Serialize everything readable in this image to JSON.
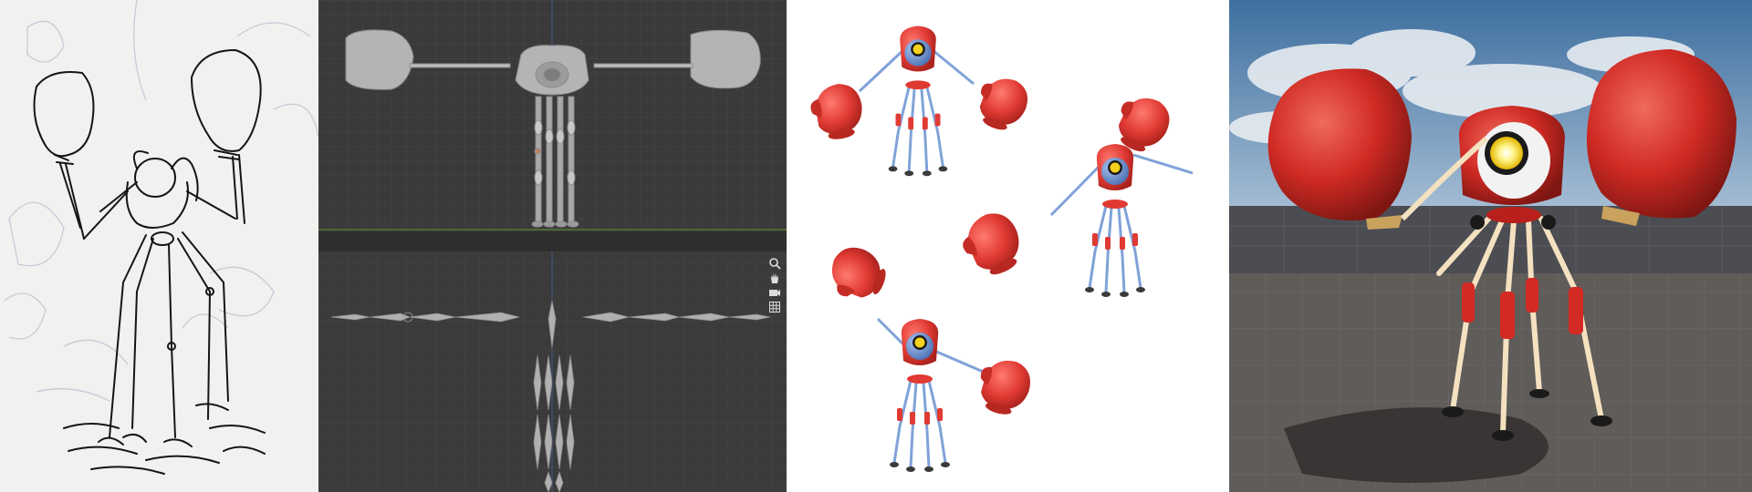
{
  "panels": [
    {
      "id": "concept-sketch",
      "kind": "pencil-and-ink-sketch"
    },
    {
      "id": "blender-viewport",
      "kind": "3d-viewport-two-views"
    },
    {
      "id": "character-renders",
      "kind": "three-poses-on-white"
    },
    {
      "id": "engine-preview",
      "kind": "in-engine-scene"
    }
  ],
  "viewport_tools": [
    {
      "name": "zoom-icon"
    },
    {
      "name": "hand-icon"
    },
    {
      "name": "camera-icon"
    },
    {
      "name": "grid-icon"
    }
  ],
  "colors": {
    "sketch_paper": "#f1f1ef",
    "viewport_bg": "#3b3b3b",
    "viewport_grid": "#4a4a4a",
    "robot_red": "#e03a33",
    "robot_blue": "#6b8ec9",
    "eye_yellow": "#f5d21d",
    "sky": "#7e8fa3",
    "floor": "#5e5b59"
  }
}
